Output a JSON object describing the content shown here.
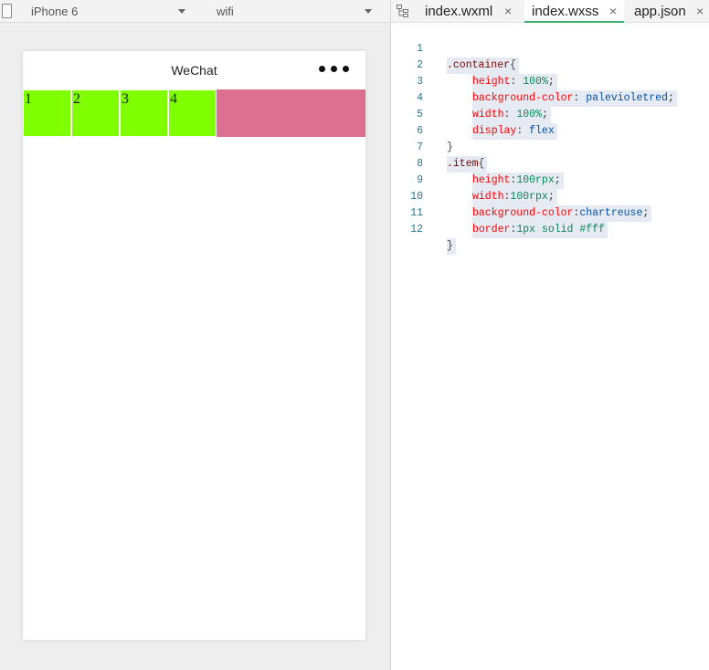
{
  "simulator": {
    "device": "iPhone 6",
    "network": "wifi",
    "nav_title": "WeChat",
    "items": [
      "1",
      "2",
      "3",
      "4"
    ]
  },
  "editor": {
    "tabs": [
      {
        "label": "index.wxml",
        "active": false
      },
      {
        "label": "index.wxss",
        "active": true
      },
      {
        "label": "app.json",
        "active": false
      }
    ],
    "close_glyph": "×",
    "line_numbers": [
      "1",
      "2",
      "3",
      "4",
      "5",
      "6",
      "7",
      "8",
      "9",
      "10",
      "11",
      "12"
    ],
    "code": {
      "l1_sel": ".container",
      "l1_brace": "{",
      "l2_prop": "height",
      "l2_val": "100%",
      "l3_prop": "background-color",
      "l3_val": "palevioletred",
      "l4_prop": "width",
      "l4_val": "100%",
      "l5_prop": "display",
      "l5_val": "flex",
      "l6": "}",
      "l7_sel": ".item",
      "l7_brace": "{",
      "l8_prop": "height",
      "l8_val": "100rpx",
      "l9_prop": "width",
      "l9_val": "100rpx",
      "l10_prop": "background-color",
      "l10_val": "chartreuse",
      "l11_prop": "border",
      "l11_val": "1px solid #fff",
      "l12": "}"
    }
  },
  "colors": {
    "container_bg": "#db7093",
    "item_bg": "#7fff00",
    "active_tab_underline": "#3cb371"
  }
}
